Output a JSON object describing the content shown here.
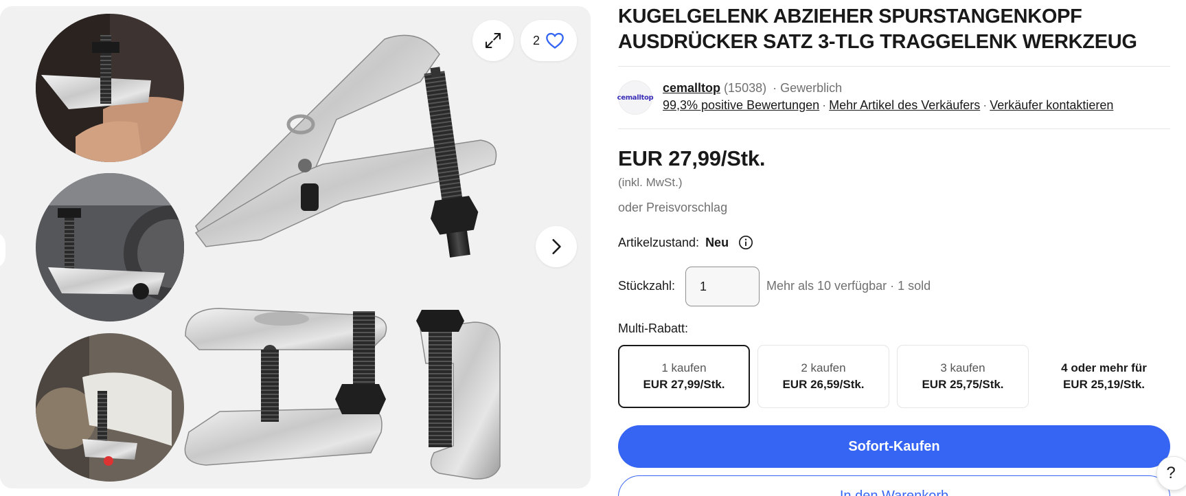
{
  "product": {
    "title": "KUGELGELENK ABZIEHER SPURSTANGENKOPF AUSDRÜCKER SATZ 3-TLG TRAGGELENK WERKZEUG"
  },
  "gallery": {
    "favorite_count": "2",
    "icons": [
      "expand-icon",
      "heart-icon",
      "chevron-right-icon",
      "chevron-left-icon"
    ]
  },
  "seller": {
    "logo_text": "cemalltop",
    "name": "cemalltop",
    "rating_count": "(15038)",
    "type": "Gewerblich",
    "feedback_link": "99,3% positive Bewertungen",
    "more_items_link": "Mehr Artikel des Verkäufers",
    "contact_link": "Verkäufer kontaktieren"
  },
  "pricing": {
    "price": "EUR 27,99/Stk.",
    "vat_note": "(inkl. MwSt.)",
    "offer_text": "oder Preisvorschlag"
  },
  "condition": {
    "label": "Artikelzustand:",
    "value": "Neu"
  },
  "quantity": {
    "label": "Stückzahl:",
    "value": "1",
    "availability": "Mehr als 10 verfügbar · 1 sold"
  },
  "multi_discount": {
    "label": "Multi-Rabatt:",
    "tiers": [
      {
        "qty": "1 kaufen",
        "price": "EUR 27,99/Stk.",
        "selected": true
      },
      {
        "qty": "2 kaufen",
        "price": "EUR 26,59/Stk."
      },
      {
        "qty": "3 kaufen",
        "price": "EUR 25,75/Stk."
      },
      {
        "qty": "4 oder mehr für",
        "price": "EUR 25,19/Stk."
      }
    ]
  },
  "actions": {
    "buy_now": "Sofort-Kaufen",
    "add_to_cart": "In den Warenkorb",
    "help": "?"
  },
  "colors": {
    "primary": "#3665f3",
    "text": "#191919",
    "muted": "#707070",
    "gallery_bg": "#f1f1f1"
  }
}
